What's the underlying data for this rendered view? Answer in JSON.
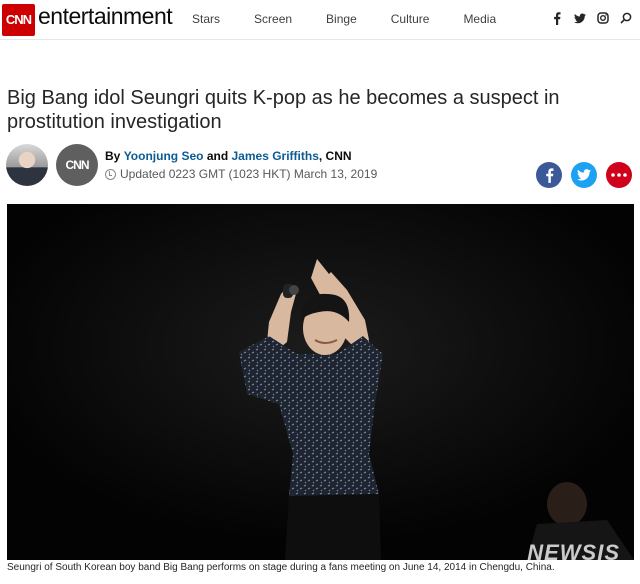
{
  "brand": {
    "logo": "CNN",
    "section": "entertainment"
  },
  "nav": {
    "links": [
      "Stars",
      "Screen",
      "Binge",
      "Culture",
      "Media"
    ],
    "icons": [
      "facebook-icon",
      "twitter-icon",
      "instagram-icon",
      "search-icon"
    ]
  },
  "article": {
    "headline": "Big Bang idol Seungri quits K-pop as he becomes a suspect in prostitution investigation",
    "byline": {
      "prefix": "By",
      "author1": "Yoonjung Seo",
      "and": "and",
      "author2": "James Griffiths",
      "outlet": ", CNN"
    },
    "updated": "Updated 0223 GMT (1023 HKT) March 13, 2019",
    "badge": "CNN",
    "caption": "Seungri of South Korean boy band Big Bang performs on stage during a fans meeting on June 14, 2014 in Chengdu, China.",
    "watermark": "NEWSIS"
  },
  "share": [
    "facebook-share-icon",
    "twitter-share-icon",
    "more-icon"
  ],
  "colors": {
    "cnn_red": "#cc0000",
    "facebook": "#3b5998",
    "twitter": "#1da1f2",
    "more": "#d0021b",
    "link": "#0c5c94"
  }
}
